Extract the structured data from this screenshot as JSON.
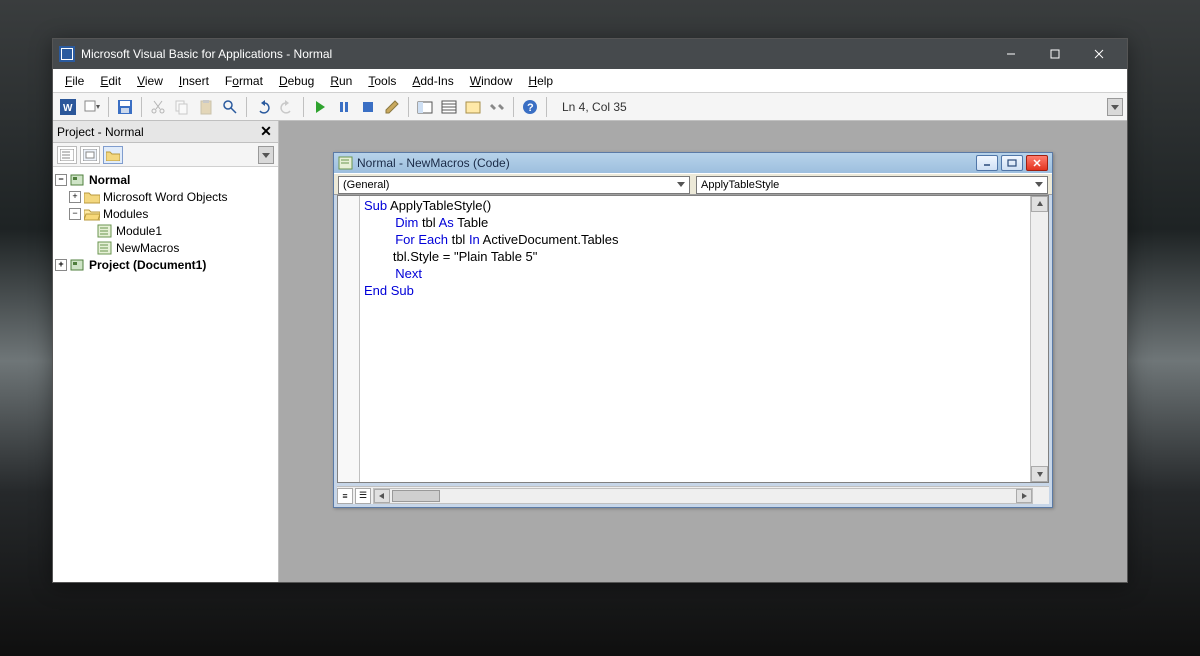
{
  "window": {
    "title": "Microsoft Visual Basic for Applications - Normal"
  },
  "menu": [
    "File",
    "Edit",
    "View",
    "Insert",
    "Format",
    "Debug",
    "Run",
    "Tools",
    "Add-Ins",
    "Window",
    "Help"
  ],
  "toolbar": {
    "icons": [
      "word",
      "view-dd",
      "save",
      "cut",
      "copy",
      "paste",
      "find",
      "undo",
      "redo",
      "run",
      "pause",
      "stop",
      "design",
      "project-explorer",
      "properties",
      "object-browser",
      "toolbox",
      "help"
    ],
    "cursor_pos": "Ln 4, Col 35"
  },
  "project_panel": {
    "title": "Project - Normal",
    "tree": {
      "normal": {
        "label": "Normal"
      },
      "word_objects": {
        "label": "Microsoft Word Objects"
      },
      "modules": {
        "label": "Modules"
      },
      "module1": {
        "label": "Module1"
      },
      "newmacros": {
        "label": "NewMacros"
      },
      "project_doc1": {
        "label": "Project (Document1)"
      }
    }
  },
  "code_window": {
    "title": "Normal - NewMacros (Code)",
    "combo_left": "(General)",
    "combo_right": "ApplyTableStyle",
    "code": {
      "l1_kw": "Sub",
      "l1_rest": " ApplyTableStyle()",
      "l2_kw": "Dim",
      "l2_rest": " tbl ",
      "l2_kw2": "As",
      "l2_rest2": " Table",
      "l3_kw": "For Each",
      "l3_rest": " tbl ",
      "l3_kw2": "In",
      "l3_rest2": " ActiveDocument.Tables",
      "l4_indent": "        tbl.Style = ",
      "l4_str": "\"Plain Table 5\"",
      "l5_kw": "Next",
      "l6_kw": "End Sub"
    }
  }
}
